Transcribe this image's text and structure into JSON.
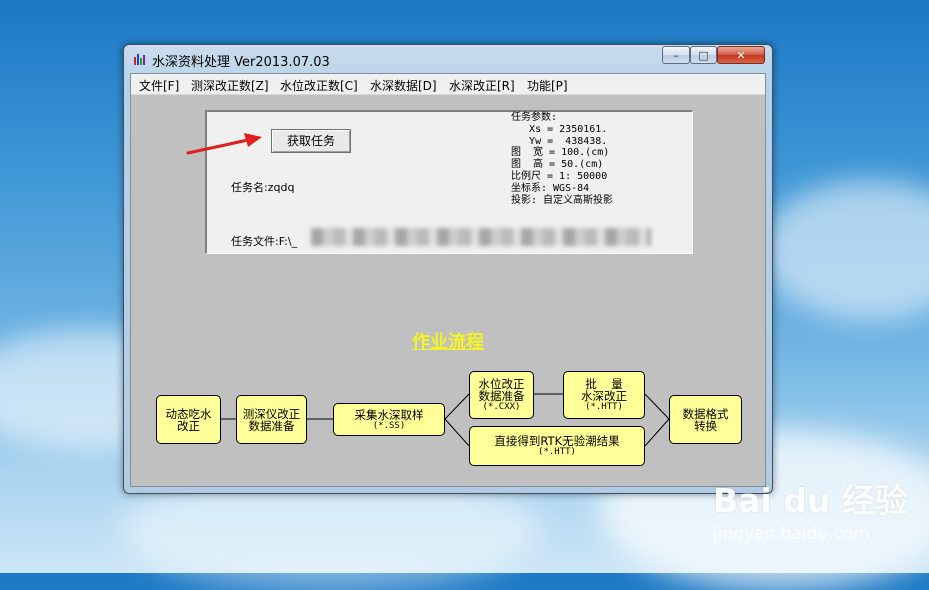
{
  "window": {
    "title": "水深资料处理 Ver2013.07.03"
  },
  "controls": {
    "minimize": "–",
    "maximize": "□",
    "close": "✕"
  },
  "menu": [
    "文件[F]",
    "测深改正数[Z]",
    "水位改正数[C]",
    "水深数据[D]",
    "水深改正[R]",
    "功能[P]"
  ],
  "task": {
    "button": "获取任务",
    "name_label": "任务名:zqdq",
    "file_label": "任务文件:F:\\_"
  },
  "params": {
    "title": "任务参数:",
    "lines": [
      "   Xs = 2350161.",
      "   Yw =  438438.",
      "图  宽 = 100.(cm)",
      "图  高 = 50.(cm)",
      "比例尺 = 1: 50000",
      "坐标系: WGS-84",
      "投影: 自定义高斯投影"
    ]
  },
  "flow": {
    "title": "作业流程",
    "nodes": {
      "dynamic": [
        "动态吃水",
        "改正"
      ],
      "sounder": [
        "测深仪改正",
        "数据准备"
      ],
      "collect": [
        "采集水深取样",
        "(*.SS)"
      ],
      "tide": [
        "水位改正",
        "数据准备",
        "(*.CXX)"
      ],
      "batch": [
        "批    量",
        "水深改正",
        "(*.HTT)"
      ],
      "rtk": [
        "直接得到RTK无验潮结果",
        "(*.HTT)"
      ],
      "format": [
        "数据格式",
        "转换"
      ]
    }
  },
  "watermark": {
    "brand": "Bai du 经验",
    "url": "jingyan.baidu.com"
  },
  "colors": {
    "node_fill": "#ffff99",
    "flow_title": "#f5f520",
    "arrow": "#e02020"
  }
}
